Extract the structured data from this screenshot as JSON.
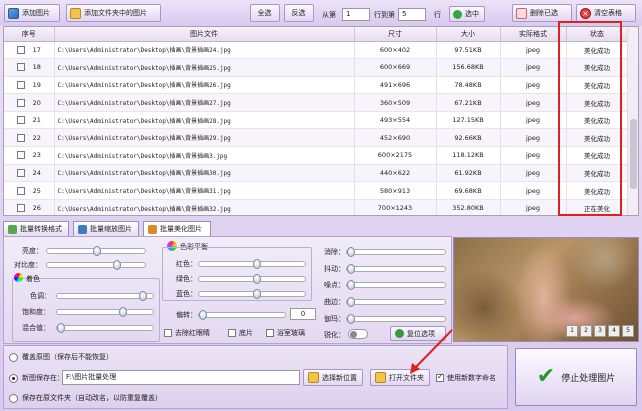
{
  "toolbar": {
    "add_image": "添加图片",
    "add_folder": "添加文件夹中的图片",
    "select_all": "全选",
    "invert": "反选",
    "from_label": "从第",
    "from_value": "1",
    "to_label": "行到第",
    "to_value": "5",
    "row_label": "行",
    "select_label": "选中",
    "delete_selected": "删除已选",
    "clear_table": "清空表格"
  },
  "table": {
    "headers": [
      "序号",
      "图片文件",
      "尺寸",
      "大小",
      "实际格式",
      "状态"
    ],
    "rows": [
      [
        "17",
        "C:\\Users\\Administrator\\Desktop\\插画\\背景插画24.jpg",
        "600×402",
        "97.51KB",
        "jpeg",
        "美化成功"
      ],
      [
        "18",
        "C:\\Users\\Administrator\\Desktop\\插画\\背景插画25.jpg",
        "600×669",
        "156.68KB",
        "jpeg",
        "美化成功"
      ],
      [
        "19",
        "C:\\Users\\Administrator\\Desktop\\插画\\背景插画26.jpg",
        "491×696",
        "78.48KB",
        "jpeg",
        "美化成功"
      ],
      [
        "20",
        "C:\\Users\\Administrator\\Desktop\\插画\\背景插画27.jpg",
        "360×509",
        "67.21KB",
        "jpeg",
        "美化成功"
      ],
      [
        "21",
        "C:\\Users\\Administrator\\Desktop\\插画\\背景插画28.jpg",
        "493×554",
        "127.15KB",
        "jpeg",
        "美化成功"
      ],
      [
        "22",
        "C:\\Users\\Administrator\\Desktop\\插画\\背景插画29.jpg",
        "452×690",
        "92.66KB",
        "jpeg",
        "美化成功"
      ],
      [
        "23",
        "C:\\Users\\Administrator\\Desktop\\插画\\背景插画3.jpg",
        "600×2175",
        "118.12KB",
        "jpeg",
        "美化成功"
      ],
      [
        "24",
        "C:\\Users\\Administrator\\Desktop\\插画\\背景插画30.jpg",
        "440×622",
        "61.92KB",
        "jpeg",
        "美化成功"
      ],
      [
        "25",
        "C:\\Users\\Administrator\\Desktop\\插画\\背景插画31.jpg",
        "580×913",
        "69.68KB",
        "jpeg",
        "美化成功"
      ],
      [
        "26",
        "C:\\Users\\Administrator\\Desktop\\插画\\背景插画32.jpg",
        "700×1243",
        "352.80KB",
        "jpeg",
        "正在美化"
      ]
    ]
  },
  "tabs": [
    "批量转换格式",
    "批量缩放图片",
    "批量美化图片"
  ],
  "adjust": {
    "brightness": "亮度：",
    "contrast": "对比度：",
    "tone_title": "着色",
    "hue": "色调：",
    "saturation": "饱和度：",
    "mix": "混合值：",
    "balance_title": "色彩平衡",
    "red": "红色：",
    "green": "绿色：",
    "blue": "蓝色：",
    "tilt": "偏转：",
    "tilt_value": "0",
    "redeye": "去除红眼睛",
    "negative": "底片",
    "glass": "浴室玻璃",
    "blur": "消除：",
    "jitter": "抖动：",
    "noise": "噪点：",
    "emboss": "曲边：",
    "gamma": "伽玛：",
    "sharpen": "锐化：",
    "reset": "复位选项"
  },
  "preview": {
    "buttons": [
      "1",
      "2",
      "3",
      "4",
      "5"
    ]
  },
  "output": {
    "overwrite": "覆盖原图（保存后不能恢复）",
    "save_new": "新图保存在：",
    "path": "F:\\图片批量处理",
    "choose": "选择新位置",
    "open_folder": "打开文件夹",
    "use_new_name": "使用新数字命名",
    "save_original": "保存在原文件夹（自动改名，以防重复覆盖）"
  },
  "stop_button": "停止处理图片",
  "colors": {
    "highlight": "#e02020",
    "accent": "#1f9b2a"
  }
}
